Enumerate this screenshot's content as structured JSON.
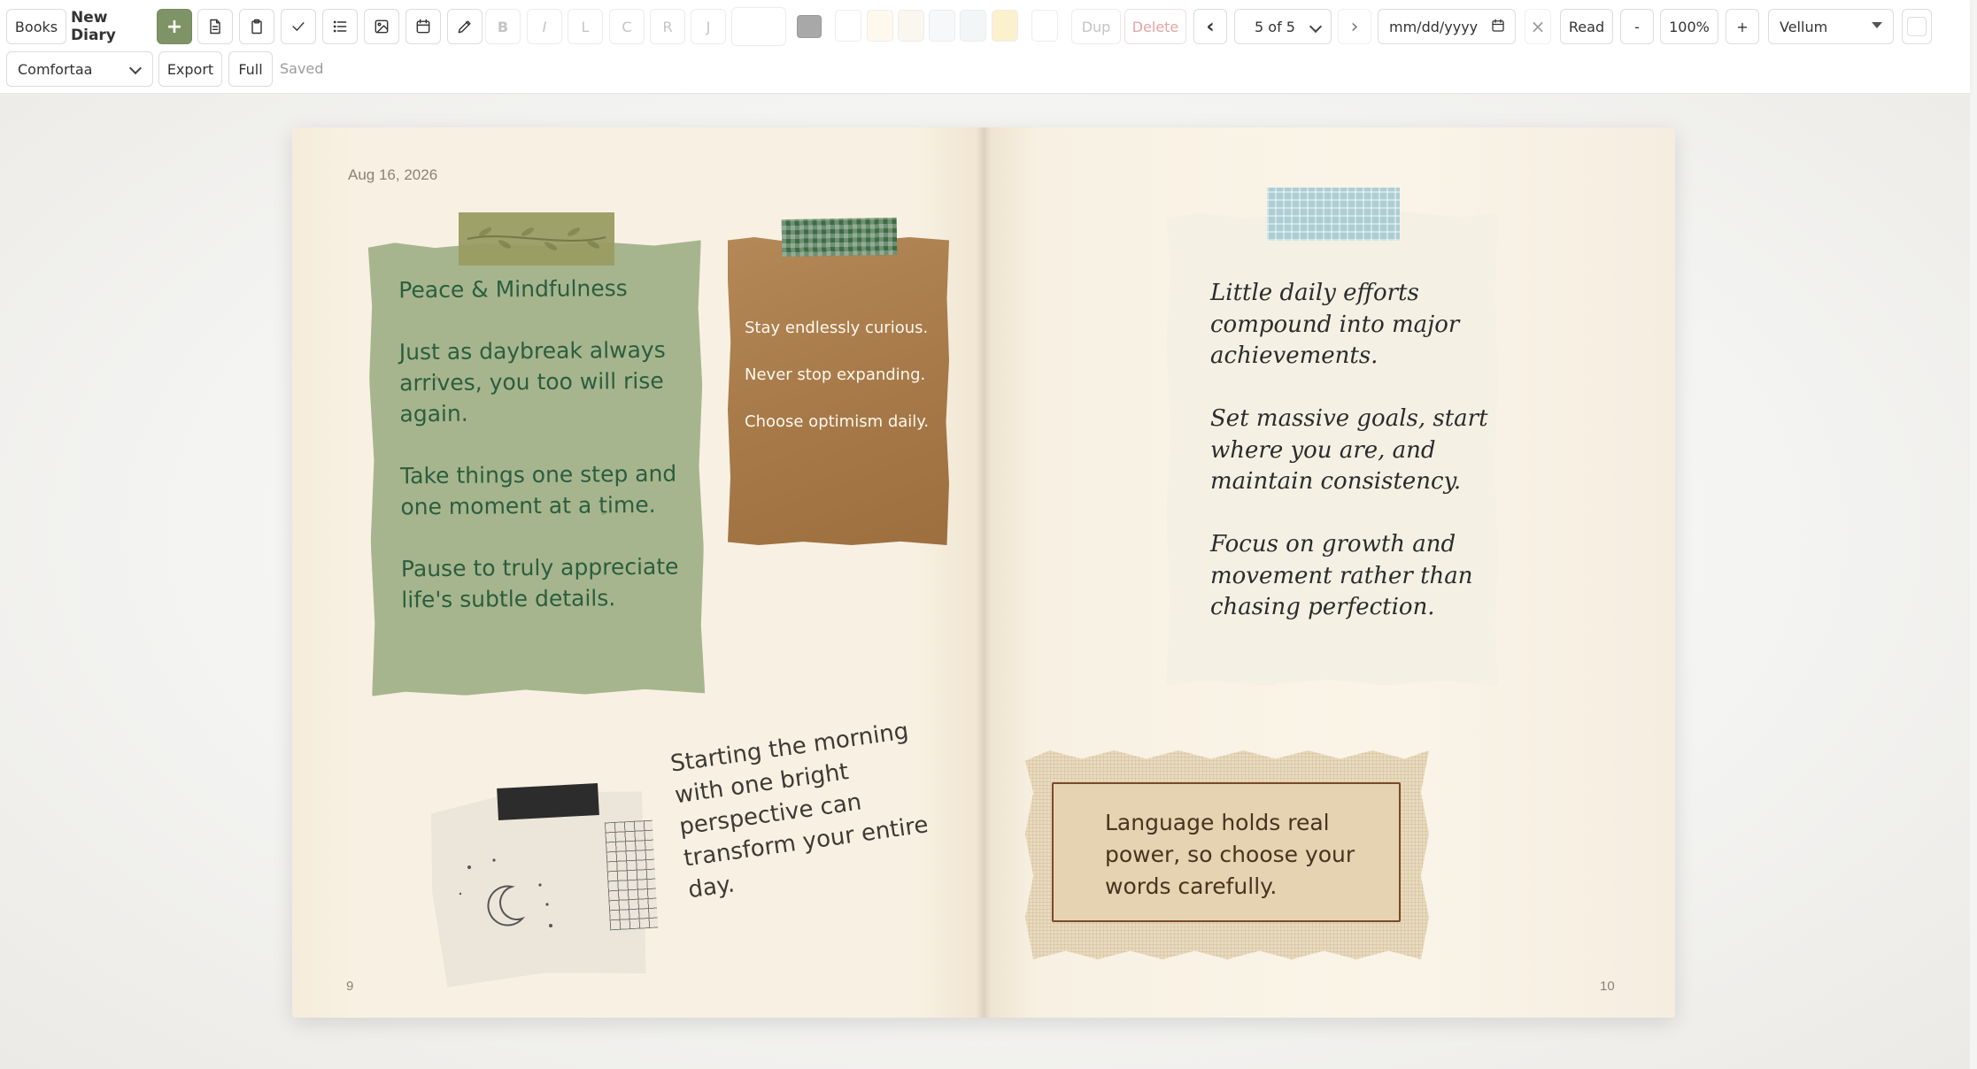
{
  "toolbar": {
    "books_label": "Books",
    "diary_title": "New Diary",
    "add_label": "+",
    "bold_label": "B",
    "italic_label": "I",
    "align_left_label": "L",
    "align_center_label": "C",
    "align_right_label": "R",
    "align_justify_label": "J",
    "font_size_value": "",
    "swatch_colors": [
      "#ffffff",
      "#fdf9ec",
      "#f9f7ef",
      "#f6f8f9",
      "#f3f6f7",
      "#fbf1cc",
      "#ffffff"
    ],
    "dup_label": "Dup",
    "delete_label": "Delete",
    "prev_label": "‹",
    "page_indicator": "5 of 5",
    "next_label": "›",
    "date_placeholder": "mm/dd/yyyy",
    "clear_date_label": "×",
    "read_label": "Read",
    "zoom_out_label": "-",
    "zoom_value": "100%",
    "zoom_in_label": "+",
    "paper_style": "Vellum",
    "font_family_value": "Comfortaa",
    "export_label": "Export",
    "full_label": "Full",
    "save_status": "Saved"
  },
  "icons": {
    "page": "page-icon",
    "clipboard": "clipboard-icon",
    "check": "check-icon",
    "list": "list-icon",
    "image": "image-icon",
    "calendar": "calendar-icon",
    "pen": "pen-icon"
  },
  "colors": {
    "accent": "#7f9466",
    "green_note": "#a7b58e",
    "green_text": "#2a5e3e",
    "brown_note": "#a87a49",
    "cream_note": "#f4f1e4",
    "fabric": "#e8dabd",
    "page": "#f8f1e3"
  },
  "diary": {
    "left_page": {
      "date": "Aug 16, 2026",
      "page_number": "9",
      "green_note": "Peace & Mindfulness\n\nJust as daybreak always arrives, you too will rise again.\n\nTake things one step and one moment at a time.\n\nPause to truly appreciate life's subtle details.",
      "brown_note": "Stay endlessly curious.\nNever stop expanding.\nChoose optimism daily.",
      "rotated_quote": "Starting the morning with one bright perspective can transform your entire day."
    },
    "right_page": {
      "page_number": "10",
      "cream_note": "Little daily efforts compound into major achievements.\n\nSet massive goals, start where you are, and maintain consistency.\n\nFocus on growth and movement rather than chasing perfection.",
      "fabric_note": "Language holds real power, so choose your words carefully."
    }
  }
}
